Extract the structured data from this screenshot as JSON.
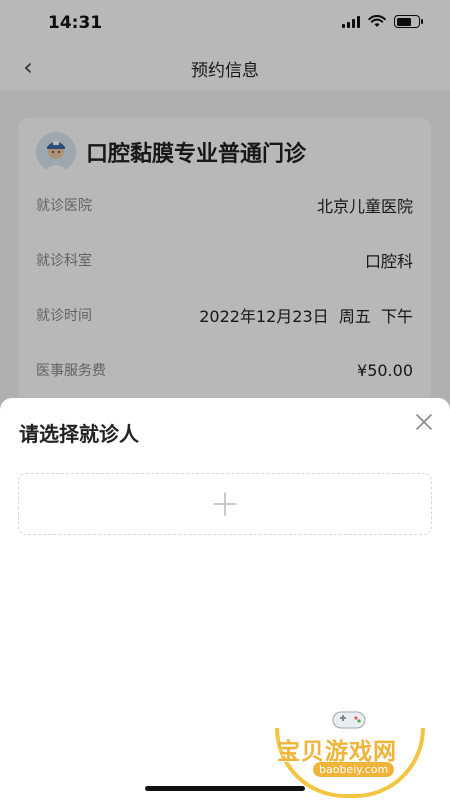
{
  "status_bar": {
    "time": "14:31"
  },
  "nav": {
    "title": "预约信息",
    "back_icon": "chevron-left-icon"
  },
  "card": {
    "title": "口腔黏膜专业普通门诊",
    "avatar_icon": "doctor-avatar-icon",
    "rows": [
      {
        "label": "就诊医院",
        "value": "北京儿童医院"
      },
      {
        "label": "就诊科室",
        "value": "口腔科"
      },
      {
        "label": "就诊时间",
        "value": "2022年12月23日  周五  下午"
      },
      {
        "label": "医事服务费",
        "value": "¥50.00"
      }
    ]
  },
  "sheet": {
    "title": "请选择就诊人",
    "close_icon": "close-icon",
    "add_icon": "plus-icon"
  },
  "watermark": {
    "text": "宝贝游戏网",
    "domain": "baobeiy.com"
  },
  "colors": {
    "watermark": "#f0b43a",
    "dashed_border": "#d8d8d8"
  }
}
